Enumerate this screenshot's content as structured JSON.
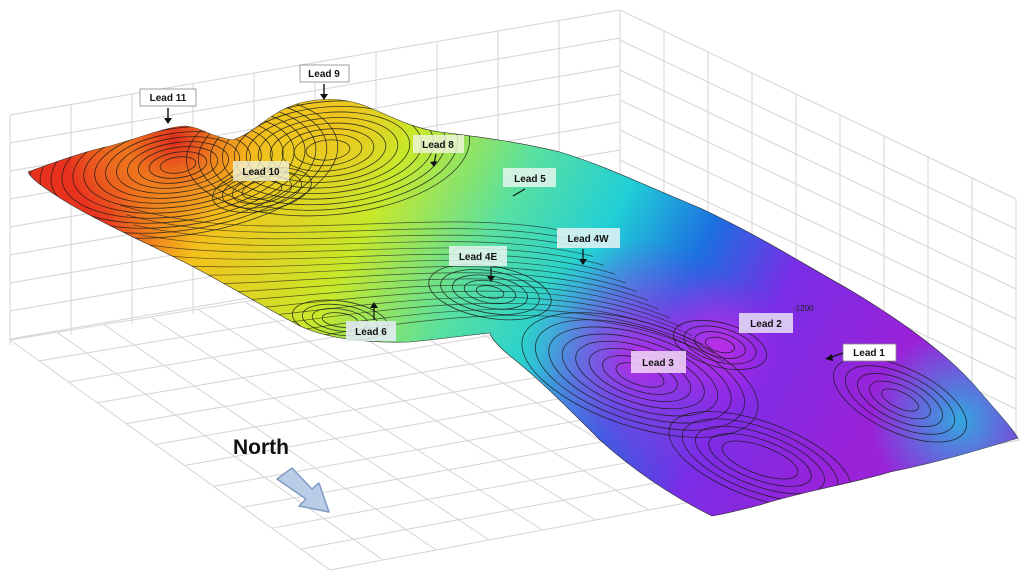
{
  "leads": [
    {
      "id": "lead-11",
      "label": "Lead 11",
      "box": "white"
    },
    {
      "id": "lead-9",
      "label": "Lead 9",
      "box": "white"
    },
    {
      "id": "lead-10",
      "label": "Lead 10",
      "box": "translucent"
    },
    {
      "id": "lead-8",
      "label": "Lead 8",
      "box": "translucent"
    },
    {
      "id": "lead-5",
      "label": "Lead 5",
      "box": "translucent"
    },
    {
      "id": "lead-4w",
      "label": "Lead 4W",
      "box": "translucent"
    },
    {
      "id": "lead-4e",
      "label": "Lead 4E",
      "box": "translucent"
    },
    {
      "id": "lead-6",
      "label": "Lead 6",
      "box": "translucent"
    },
    {
      "id": "lead-2",
      "label": "Lead 2",
      "box": "translucent"
    },
    {
      "id": "lead-3",
      "label": "Lead 3",
      "box": "translucent"
    },
    {
      "id": "lead-1",
      "label": "Lead 1",
      "box": "white"
    }
  ],
  "contour_label": "-1200",
  "north_label": "North",
  "colors": {
    "high": "#e8321e",
    "upper": "#f4c21c",
    "mid": "#8ee23a",
    "lower": "#21d6c8",
    "deep": "#1c6fe0",
    "deepest": "#b31fe6",
    "contour_line": "#1a1a1a",
    "grid_line": "#d4d4d4",
    "arrow_fill": "#b9cde6",
    "arrow_stroke": "#7f9cc4"
  }
}
